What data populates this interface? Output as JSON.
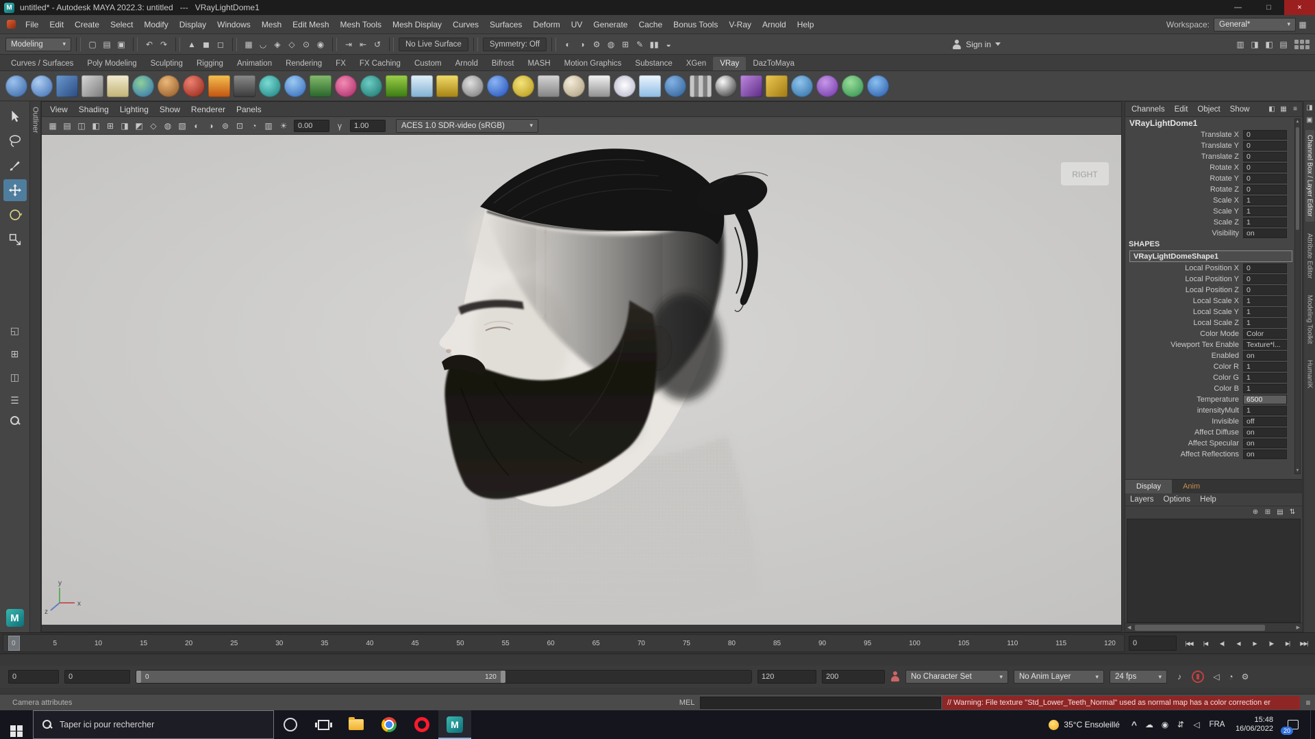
{
  "branding": {
    "logo_letter": "M"
  },
  "title_bar": {
    "title": "untitled* - Autodesk MAYA 2022.3: untitled   ---   VRayLightDome1",
    "minimize": "—",
    "maximize": "□",
    "close": "×"
  },
  "menu_bar": {
    "items": [
      "File",
      "Edit",
      "Create",
      "Select",
      "Modify",
      "Display",
      "Windows",
      "Mesh",
      "Edit Mesh",
      "Mesh Tools",
      "Mesh Display",
      "Curves",
      "Surfaces",
      "Deform",
      "UV",
      "Generate",
      "Cache",
      "Bonus Tools",
      "V-Ray",
      "Arnold",
      "Help"
    ],
    "workspace_label": "Workspace:",
    "workspace_value": "General*",
    "settings_icon": "▦"
  },
  "status_line": {
    "menuset": "Modeling",
    "file_icons": [
      {
        "n": "new-scene-icon",
        "g": "▢"
      },
      {
        "n": "open-scene-icon",
        "g": "▤"
      },
      {
        "n": "save-scene-icon",
        "g": "▣"
      }
    ],
    "undo_icons": [
      {
        "n": "undo-icon",
        "g": "↶"
      },
      {
        "n": "redo-icon",
        "g": "↷"
      }
    ],
    "mask_icons": [
      {
        "n": "select-hierarchy-icon",
        "g": "▲"
      },
      {
        "n": "select-object-icon",
        "g": "◼"
      },
      {
        "n": "select-component-icon",
        "g": "◻"
      }
    ],
    "snap_icons": [
      {
        "n": "snap-grid-icon",
        "g": "▦"
      },
      {
        "n": "snap-curve-icon",
        "g": "◡"
      },
      {
        "n": "snap-point-icon",
        "g": "◈"
      },
      {
        "n": "snap-plane-icon",
        "g": "◇"
      },
      {
        "n": "snap-center-icon",
        "g": "⊙"
      },
      {
        "n": "make-live-icon",
        "g": "◉"
      }
    ],
    "history_icons": [
      {
        "n": "input-connections-icon",
        "g": "⇥"
      },
      {
        "n": "output-connections-icon",
        "g": "⇤"
      },
      {
        "n": "construction-history-icon",
        "g": "↺"
      }
    ],
    "live_surface": "No Live Surface",
    "symmetry": "Symmetry: Off",
    "mid_icons": [
      {
        "n": "render-view-icon",
        "g": "◐"
      },
      {
        "n": "ipr-render-icon",
        "g": "◑"
      },
      {
        "n": "render-settings-icon",
        "g": "⚙"
      },
      {
        "n": "hypershade-icon",
        "g": "◍"
      },
      {
        "n": "node-editor-icon",
        "g": "⊞"
      },
      {
        "n": "paint-effects-icon",
        "g": "✎"
      },
      {
        "n": "pause-icon",
        "g": "▮▮"
      },
      {
        "n": "clip-icon",
        "g": "◒"
      }
    ],
    "signin_label": "Sign in",
    "right_icons": [
      {
        "n": "ui-toggle-modeling-toolkit-icon",
        "g": "▥"
      },
      {
        "n": "ui-toggle-attribute-editor-icon",
        "g": "◨"
      },
      {
        "n": "ui-toggle-tool-settings-icon",
        "g": "◧"
      },
      {
        "n": "ui-toggle-channel-box-icon",
        "g": "▤"
      }
    ]
  },
  "shelf": {
    "tabs": [
      {
        "label": "Curves / Surfaces"
      },
      {
        "label": "Poly Modeling"
      },
      {
        "label": "Sculpting"
      },
      {
        "label": "Rigging"
      },
      {
        "label": "Animation"
      },
      {
        "label": "Rendering"
      },
      {
        "label": "FX"
      },
      {
        "label": "FX Caching"
      },
      {
        "label": "Custom"
      },
      {
        "label": "Arnold"
      },
      {
        "label": "Bifrost"
      },
      {
        "label": "MASH"
      },
      {
        "label": "Motion Graphics"
      },
      {
        "label": "Substance"
      },
      {
        "label": "XGen"
      },
      {
        "label": "VRay",
        "cls": "active"
      },
      {
        "label": "DazToMaya"
      }
    ],
    "icons": [
      {
        "n": "nurbs-sphere-shelf-icon",
        "style": "background:radial-gradient(circle at 35% 30%,#9cc2ee,#2f5f9f);border-radius:50%"
      },
      {
        "n": "poly-sphere-shelf-icon",
        "style": "background:radial-gradient(circle at 35% 30%,#aecdf2,#3a6aae);border-radius:50%"
      },
      {
        "n": "ui-panel-shelf-icon",
        "style": "background:linear-gradient(135deg,#6a9ad0,#2a4a80);border-radius:3px"
      },
      {
        "n": "measure-shelf-icon",
        "style": "background:linear-gradient(135deg,#d8d8d8,#7a7a7a);border-radius:3px"
      },
      {
        "n": "notes-shelf-icon",
        "style": "background:linear-gradient(180deg,#f2ecd2,#c2b274);border-radius:3px"
      },
      {
        "n": "globe-shelf-icon",
        "style": "background:radial-gradient(circle at 40% 35%,#8ed09a,#2a6ab2);border-radius:50%"
      },
      {
        "n": "characters-shelf-icon",
        "style": "background:radial-gradient(circle at 40% 30%,#ecb878,#8a5020);border-radius:50%"
      },
      {
        "n": "red-material-shelf-icon",
        "style": "background:radial-gradient(circle at 35% 30%,#ee8070,#8a2012);border-radius:50%"
      },
      {
        "n": "fire-shelf-icon",
        "style": "background:linear-gradient(180deg,#f6c050,#c25210);border-radius:3px"
      },
      {
        "n": "camera-shelf-icon",
        "style": "background:linear-gradient(180deg,#8a8a8a,#3a3a3a);border-radius:3px"
      },
      {
        "n": "time-shelf-icon",
        "style": "background:radial-gradient(circle at 40% 35%,#7adcd4,#187a78);border-radius:50%"
      },
      {
        "n": "fluid-shelf-icon",
        "style": "background:radial-gradient(circle at 40% 30%,#9ccaf4,#2a62b2);border-radius:50%"
      },
      {
        "n": "tree-shelf-icon",
        "style": "background:linear-gradient(180deg,#84bc6c,#27642a);border-radius:3px"
      },
      {
        "n": "paint-shelf-icon",
        "style": "background:radial-gradient(circle at 40% 35%,#f48cb4,#a22062);border-radius:50%"
      },
      {
        "n": "toon-shelf-icon",
        "style": "background:radial-gradient(circle at 40% 35%,#6cccc4,#176f68);border-radius:50%"
      },
      {
        "n": "grass-shelf-icon",
        "style": "background:linear-gradient(180deg,#9cd048,#3a7a12);border-radius:3px"
      },
      {
        "n": "snow-shelf-icon",
        "style": "background:linear-gradient(180deg,#e2f0fa,#7fb0d2);border-radius:3px"
      },
      {
        "n": "lightning-shelf-icon",
        "style": "background:linear-gradient(180deg,#f2dc6a,#a68212);border-radius:3px"
      },
      {
        "n": "spiral-shelf-icon",
        "style": "background:radial-gradient(circle at 40% 35%,#e0e0e0,#6f6f6f);border-radius:50%"
      },
      {
        "n": "vray-sphere-shelf-icon",
        "style": "background:radial-gradient(circle at 35% 30%,#8ab4f4,#1a4ab4);border-radius:50%"
      },
      {
        "n": "disc-shelf-icon",
        "style": "background:radial-gradient(circle at 40% 35%,#f4e47a,#b29212);border-radius:50%"
      },
      {
        "n": "funnel-shelf-icon",
        "style": "background:linear-gradient(180deg,#d6d6d6,#828282);border-radius:3px"
      },
      {
        "n": "clay-sphere-shelf-icon",
        "style": "background:radial-gradient(circle at 35% 30%,#f4ecda,#a89878);border-radius:50%"
      },
      {
        "n": "cone-shelf-icon",
        "style": "background:linear-gradient(180deg,#f4f4f4,#8e8e8e);border-radius:3px"
      },
      {
        "n": "burst-shelf-icon",
        "style": "background:radial-gradient(circle at 50% 45%,#ffffff,#aeaec6);border-radius:50%"
      },
      {
        "n": "sky-plane-shelf-icon",
        "style": "background:linear-gradient(180deg,#eef6ff,#8cbce2);border-radius:3px"
      },
      {
        "n": "dome-light-shelf-icon",
        "style": "background:radial-gradient(circle at 35% 30%,#82b2e6,#29588e);border-radius:50%"
      },
      {
        "n": "columns-shelf-icon",
        "style": "background:linear-gradient(90deg,#c6c6c6 20%,#7e7e7e 21% 40%,#c6c6c6 41% 60%,#7e7e7e 61% 80%,#c6c6c6 81%);border-radius:3px"
      },
      {
        "n": "checker-sphere-shelf-icon",
        "style": "background:radial-gradient(circle at 35% 30%,#fafafa,#1e1e1e);border-radius:50%"
      },
      {
        "n": "render-camera-shelf-icon",
        "style": "background:linear-gradient(135deg,#c08ae0,#5a2a84);border-radius:3px"
      },
      {
        "n": "wrench-shelf-icon",
        "style": "background:linear-gradient(135deg,#ecc852,#a27a12);border-radius:3px"
      },
      {
        "n": "photo-shelf-icon",
        "style": "background:radial-gradient(circle at 40% 32%,#90c4ec,#2a6aa2);border-radius:50%"
      },
      {
        "n": "daz-shelf-icon",
        "style": "background:radial-gradient(circle at 40% 32%,#c698e8,#6a30a2);border-radius:50%"
      },
      {
        "n": "dots-shelf-icon",
        "style": "background:radial-gradient(circle at 40% 32%,#9ade9a,#2a8a4a);border-radius:50%"
      },
      {
        "n": "help-shelf-icon",
        "style": "background:radial-gradient(circle at 40% 32%,#8ac0f2,#2152a2);border-radius:50%"
      }
    ]
  },
  "toolbox": {
    "layouts": [
      {
        "n": "single-pane-layout-icon",
        "g": "◱"
      },
      {
        "n": "four-pane-layout-icon",
        "g": "⊞"
      },
      {
        "n": "split-pane-layout-icon",
        "g": "◫"
      },
      {
        "n": "outliner-pane-icon",
        "g": "☰"
      }
    ]
  },
  "panels": {
    "outliner_label": "Outliner"
  },
  "viewport": {
    "menus": [
      "View",
      "Shading",
      "Lighting",
      "Show",
      "Renderer",
      "Panels"
    ],
    "toolbar_icons": [
      {
        "n": "grid-icon",
        "g": "▦"
      },
      {
        "n": "film-gate-icon",
        "g": "▤"
      },
      {
        "n": "resolution-gate-icon",
        "g": "◫"
      },
      {
        "n": "gate-mask-icon",
        "g": "◧"
      },
      {
        "n": "field-chart-icon",
        "g": "⊞"
      },
      {
        "n": "safe-action-icon",
        "g": "◨"
      },
      {
        "n": "safe-title-icon",
        "g": "◩"
      },
      {
        "n": "wireframe-icon",
        "g": "◇"
      },
      {
        "n": "shaded-icon",
        "g": "◍"
      },
      {
        "n": "textured-icon",
        "g": "▧"
      },
      {
        "n": "use-all-lights-icon",
        "g": "◐"
      },
      {
        "n": "shadows-icon",
        "g": "◑"
      },
      {
        "n": "ambient-occlusion-icon",
        "g": "⊚"
      },
      {
        "n": "anti-alias-icon",
        "g": "⊡"
      },
      {
        "n": "isolate-select-icon",
        "g": "◔"
      },
      {
        "n": "xray-icon",
        "g": "▥"
      }
    ],
    "exposure_icon": "☀",
    "gamma_icon": "γ",
    "field1": "0.00",
    "field2": "1.00",
    "colorspace": "ACES 1.0 SDR-video (sRGB)",
    "view_label": "RIGHT",
    "axis": {
      "x": "x",
      "y": "y",
      "z": "z"
    }
  },
  "channel_box": {
    "menus": [
      "Channels",
      "Edit",
      "Object",
      "Show"
    ],
    "header_icons": [
      {
        "n": "channel-speed-icon",
        "g": "◧"
      },
      {
        "n": "channel-manip-icon",
        "g": "▦"
      },
      {
        "n": "channel-hyper-icon",
        "g": "≡"
      }
    ],
    "object_name": "VRayLightDome1",
    "transform_rows": [
      {
        "label": "Translate X",
        "value": "0"
      },
      {
        "label": "Translate Y",
        "value": "0"
      },
      {
        "label": "Translate Z",
        "value": "0"
      },
      {
        "label": "Rotate X",
        "value": "0"
      },
      {
        "label": "Rotate Y",
        "value": "0"
      },
      {
        "label": "Rotate Z",
        "value": "0"
      },
      {
        "label": "Scale X",
        "value": "1"
      },
      {
        "label": "Scale Y",
        "value": "1"
      },
      {
        "label": "Scale Z",
        "value": "1"
      },
      {
        "label": "Visibility",
        "value": "on"
      }
    ],
    "shapes_header": "SHAPES",
    "shape_name": "VRayLightDomeShape1",
    "shape_rows": [
      {
        "label": "Local Position X",
        "value": "0"
      },
      {
        "label": "Local Position Y",
        "value": "0"
      },
      {
        "label": "Local Position Z",
        "value": "0"
      },
      {
        "label": "Local Scale X",
        "value": "1"
      },
      {
        "label": "Local Scale Y",
        "value": "1"
      },
      {
        "label": "Local Scale Z",
        "value": "1"
      },
      {
        "label": "Color Mode",
        "value": "Color"
      },
      {
        "label": "Viewport Tex Enable",
        "value": "Texture*l..."
      },
      {
        "label": "Enabled",
        "value": "on"
      },
      {
        "label": "Color R",
        "value": "1"
      },
      {
        "label": "Color G",
        "value": "1"
      },
      {
        "label": "Color B",
        "value": "1"
      },
      {
        "label": "Temperature",
        "value": "6500",
        "cls": "sel"
      },
      {
        "label": "intensityMult",
        "value": "1"
      },
      {
        "label": "Invisible",
        "value": "off"
      },
      {
        "label": "Affect Diffuse",
        "value": "on"
      },
      {
        "label": "Affect Specular",
        "value": "on"
      },
      {
        "label": "Affect Reflections",
        "value": "on"
      }
    ]
  },
  "display_panel": {
    "tabs": [
      {
        "label": "Display",
        "cls": "active"
      },
      {
        "label": "Anim"
      }
    ],
    "menus": [
      "Layers",
      "Options",
      "Help"
    ],
    "icons": [
      {
        "n": "new-layer-icon",
        "g": "⊕"
      },
      {
        "n": "new-render-layer-icon",
        "g": "⊞"
      },
      {
        "n": "layer-options-icon",
        "g": "▤"
      },
      {
        "n": "move-layer-icon",
        "g": "⇅"
      }
    ]
  },
  "side_strip_icons": [
    {
      "n": "collapse-panel-icon",
      "g": "◨"
    },
    {
      "n": "pin-panel-icon",
      "g": "▣"
    }
  ],
  "side_tabs": [
    {
      "label": "Channel Box / Layer Editor",
      "cls": "active"
    },
    {
      "label": "Attribute Editor"
    },
    {
      "label": "Modeling Toolkit"
    },
    {
      "label": "HumanIK"
    }
  ],
  "timeline": {
    "ticks": [
      "0",
      "5",
      "10",
      "15",
      "20",
      "25",
      "30",
      "35",
      "40",
      "45",
      "50",
      "55",
      "60",
      "65",
      "70",
      "75",
      "80",
      "85",
      "90",
      "95",
      "100",
      "105",
      "110",
      "115",
      "120"
    ],
    "current": "0",
    "playback": [
      {
        "n": "go-to-start-button",
        "g": "|◀◀"
      },
      {
        "n": "prev-key-button",
        "g": "|◀"
      },
      {
        "n": "step-back-button",
        "g": "◀|"
      },
      {
        "n": "play-backward-button",
        "g": "◀"
      },
      {
        "n": "play-forward-button",
        "g": "▶"
      },
      {
        "n": "step-forward-button",
        "g": "|▶"
      },
      {
        "n": "next-key-button",
        "g": "▶|"
      },
      {
        "n": "go-to-end-button",
        "g": "▶▶|"
      }
    ]
  },
  "range": {
    "anim_start": "0",
    "play_start": "0",
    "bar_start": "0",
    "bar_end": "120",
    "play_end": "120",
    "anim_end": "200",
    "character_set": "No Character Set",
    "anim_layer": "No Anim Layer",
    "fps": "24 fps",
    "lead_icons": [
      {
        "n": "audio-icon",
        "g": "♪"
      }
    ],
    "trail_icons": [
      {
        "n": "volume-icon",
        "g": "◁"
      },
      {
        "n": "playback-speed-icon",
        "g": "◔"
      },
      {
        "n": "animation-preferences-icon",
        "g": "⚙"
      }
    ]
  },
  "command_line": {
    "help": "Camera attributes",
    "mel": "MEL",
    "warning": "// Warning: File texture \"Std_Lower_Teeth_Normal\" used as normal map has a color correction er",
    "script_icon": "≡"
  },
  "taskbar": {
    "search_placeholder": "Taper ici pour rechercher",
    "weather": "35°C Ensoleillé",
    "chevron": "^",
    "tray_icons": [
      {
        "n": "onedrive-icon",
        "g": "☁"
      },
      {
        "n": "antivirus-icon",
        "g": "◉"
      },
      {
        "n": "network-icon",
        "g": "⇵"
      },
      {
        "n": "volume-icon",
        "g": "◁"
      }
    ],
    "lang": "FRA",
    "time": "15:48",
    "date": "16/06/2022",
    "badge": "20"
  }
}
